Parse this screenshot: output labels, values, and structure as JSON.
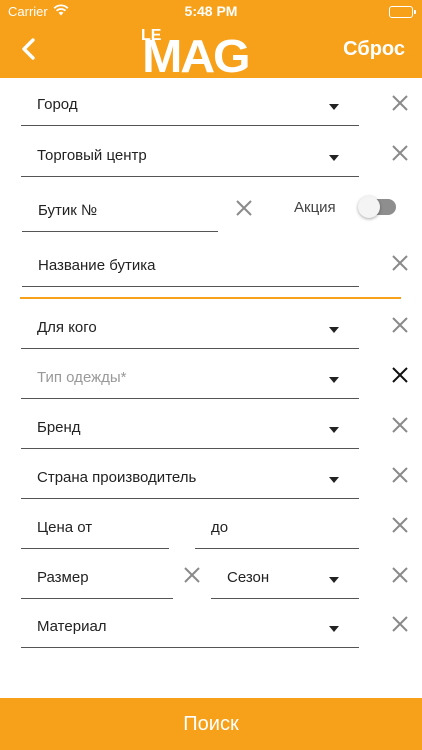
{
  "status_bar": {
    "carrier": "Carrier",
    "time": "5:48 PM"
  },
  "header": {
    "logo_text_small": "LE",
    "logo_text_big": "MAG",
    "reset_label": "Сброс",
    "accent_color": "#F7A11A"
  },
  "form": {
    "city": "Город",
    "mall": "Торговый центр",
    "boutique_no": "Бутик №",
    "promo_label": "Акция",
    "promo_on": false,
    "boutique_name": "Название бутика",
    "for_whom": "Для кого",
    "clothing_type_placeholder": "Тип одежды*",
    "brand": "Бренд",
    "country": "Страна производитель",
    "price_from": "Цена от",
    "price_to": "до",
    "size": "Размер",
    "season": "Сезон",
    "material": "Материал"
  },
  "footer": {
    "search_label": "Поиск"
  }
}
